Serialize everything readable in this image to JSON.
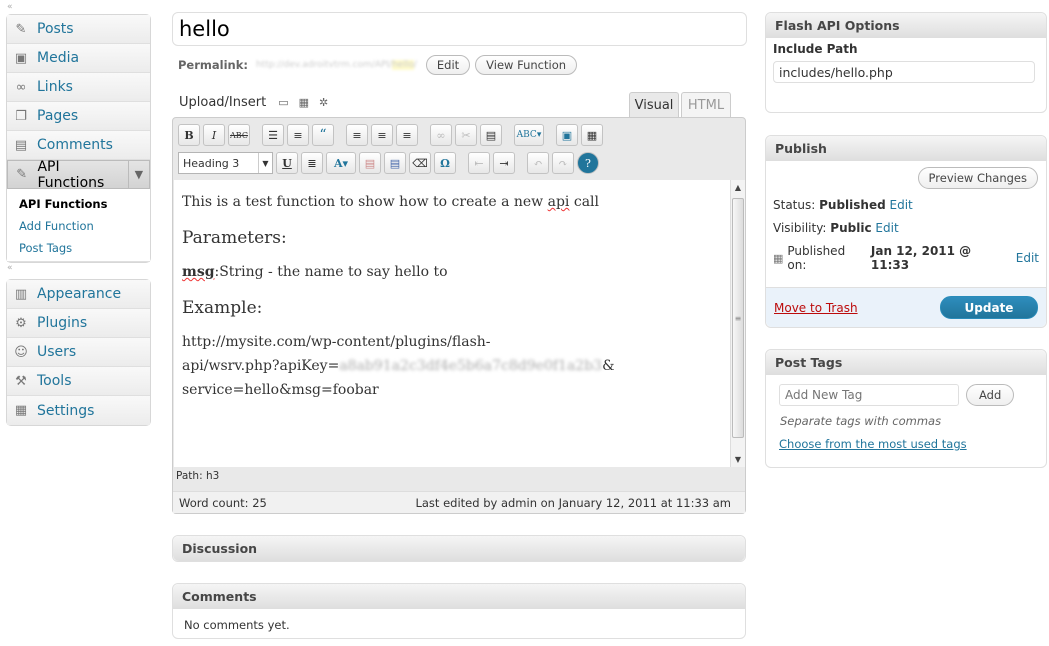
{
  "menu": {
    "group1": [
      {
        "label": "Posts",
        "icon": "pushpin-icon"
      },
      {
        "label": "Media",
        "icon": "media-icon"
      },
      {
        "label": "Links",
        "icon": "links-icon"
      },
      {
        "label": "Pages",
        "icon": "pages-icon"
      },
      {
        "label": "Comments",
        "icon": "comments-icon"
      }
    ],
    "current": {
      "label": "API Functions",
      "icon": "pushpin-icon"
    },
    "submenu": [
      "API Functions",
      "Add Function",
      "Post Tags"
    ],
    "group2": [
      {
        "label": "Appearance",
        "icon": "appearance-icon"
      },
      {
        "label": "Plugins",
        "icon": "plugins-icon"
      },
      {
        "label": "Users",
        "icon": "users-icon"
      },
      {
        "label": "Tools",
        "icon": "tools-icon"
      },
      {
        "label": "Settings",
        "icon": "settings-icon"
      }
    ]
  },
  "post": {
    "title": "hello",
    "permalink_label": "Permalink:",
    "permalink_url": "http://dev.adroitvtrm.com/API/",
    "permalink_slug": "hello",
    "permalink_tail": "/",
    "edit_button": "Edit",
    "view_button": "View Function"
  },
  "editor": {
    "upload_insert": "Upload/Insert",
    "tab_visual": "Visual",
    "tab_html": "HTML",
    "format_select": "Heading 3",
    "content": {
      "line1_pre": "This is a test function to show how to create a new ",
      "line1_squiggle": "api",
      "line1_post": " call",
      "heading1": "Parameters:",
      "param_name": "msg",
      "param_desc": ":String - the name to say hello to",
      "heading2": "Example:",
      "url_line1": "http://mysite.com/wp-content/plugins/flash-",
      "url_line2_pre": "api/wsrv.php?apiKey=",
      "url_line2_key": "a8ab91a2c3df4e5b6a7c8d9e0f1a2b3",
      "url_line2_post": "&",
      "url_line3": "service=hello&msg=foobar"
    },
    "path": "Path: h3",
    "word_count": "Word count: 25",
    "last_edited": "Last edited by admin on January 12, 2011 at 11:33 am"
  },
  "discussion": {
    "title": "Discussion"
  },
  "comments": {
    "title": "Comments",
    "empty": "No comments yet."
  },
  "flash_api": {
    "title": "Flash API Options",
    "include_label": "Include Path",
    "include_value": "includes/hello.php"
  },
  "publish": {
    "title": "Publish",
    "preview_button": "Preview Changes",
    "status_label": "Status:",
    "status_value": "Published",
    "visibility_label": "Visibility:",
    "visibility_value": "Public",
    "published_label": "Published on:",
    "published_value": "Jan 12, 2011 @ 11:33",
    "edit_link": "Edit",
    "trash": "Move to Trash",
    "update": "Update"
  },
  "tags": {
    "title": "Post Tags",
    "placeholder": "Add New Tag",
    "add_button": "Add",
    "hint": "Separate tags with commas",
    "choose": "Choose from the most used tags"
  },
  "colors": {
    "link": "#21759b",
    "trash": "#bc0b0b",
    "update": "#21759b"
  }
}
